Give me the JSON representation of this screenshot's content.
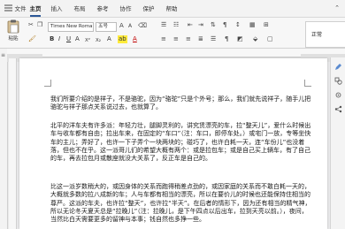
{
  "tabs": [
    "文件",
    "主页",
    "插入",
    "布局",
    "参考",
    "协作",
    "保护",
    "帮助"
  ],
  "active_tab": "主页",
  "ribbon": {
    "paste_label": "粘贴",
    "font_name": "Times New Roma",
    "font_size": "五号",
    "style_label": "正常"
  },
  "document": {
    "paragraphs": [
      "我们所要介绍的是祥子，不是骆驼，因为“骆驼”只是个外号；那么，我们就先说祥子，随手儿把骆驼与祥子那点关系说过去，也就算了。",
      "北平的洋车夫有许多派：年轻力壮，腿脚灵利的，讲究赁漂亮的车，拉“整天儿”，爱什么时候出车与收车都有自由；拉出车来，在固定的“车口”（注：车口，即停车处。）或宅门一放，专等坐快车的主儿；弄好了，也许一下子弄个一块两块的；碰巧了，也许白耗一天，连“车份儿”也没着落，但也不在乎。这一派哥儿们的希望大概有两个：或是拉包车；或是自己买上辆车，有了自己的车，再去拉包月或散座就没大关系了，反正车是自己的。",
      "比这一派岁数稍大的，或因身体的关系而跑得稍差点劲的，或因家庭的关系而不敢白耗一天的，大概就多数的拉八成新的车；人与车都有相当的漂亮，所以在要价儿的时候也还能保持住相当的尊严。这派的车夫，也许拉“整天”，也许拉“半天”。在后者的情形下，因为还有相当的精气神，所以无论冬天夏天总是“拉晚儿”（注：拉晚儿，是下午四点以后出车，拉到天亮以前。），夜间，当然比白天需要更多的留神与本事；钱自然也多挣一些。"
    ]
  }
}
